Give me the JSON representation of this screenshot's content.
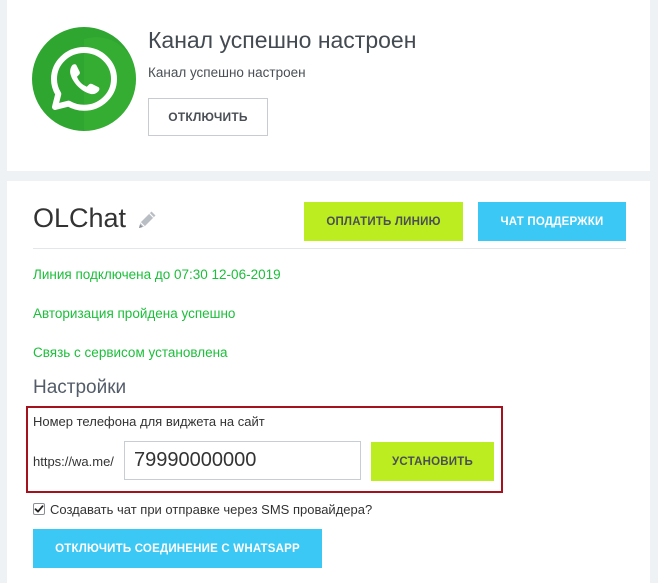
{
  "channel": {
    "title": "Канал успешно настроен",
    "subtitle": "Канал успешно настроен",
    "disconnect_label": "ОТКЛЮЧИТЬ",
    "logo_icon": "whatsapp-icon"
  },
  "line": {
    "title": "OLChat",
    "edit_icon": "pencil-icon",
    "pay_label": "ОПЛАТИТЬ ЛИНИЮ",
    "support_label": "ЧАТ ПОДДЕРЖКИ",
    "statuses": [
      "Линия подключена до 07:30 12-06-2019",
      "Авторизация пройдена успешно",
      "Связь с сервисом установлена"
    ]
  },
  "settings": {
    "title": "Настройки",
    "phone_label": "Номер телефона для виджета на сайт",
    "prefix": "https://wa.me/",
    "phone_value": "79990000000",
    "set_label": "УСТАНОВИТЬ",
    "sms_checkbox_label": "Создавать чат при отправке через SMS провайдера?",
    "sms_checkbox_checked": true,
    "disconnect_wa_label": "ОТКЛЮЧИТЬ СОЕДИНЕНИЕ С WHATSAPP"
  },
  "colors": {
    "page_bg": "#eef2f4",
    "status_green": "#1bbf3a",
    "button_green": "#bbed21",
    "button_blue": "#3bc8f5",
    "highlight_red": "#a3121d",
    "whatsapp_green": "#2fa630"
  }
}
